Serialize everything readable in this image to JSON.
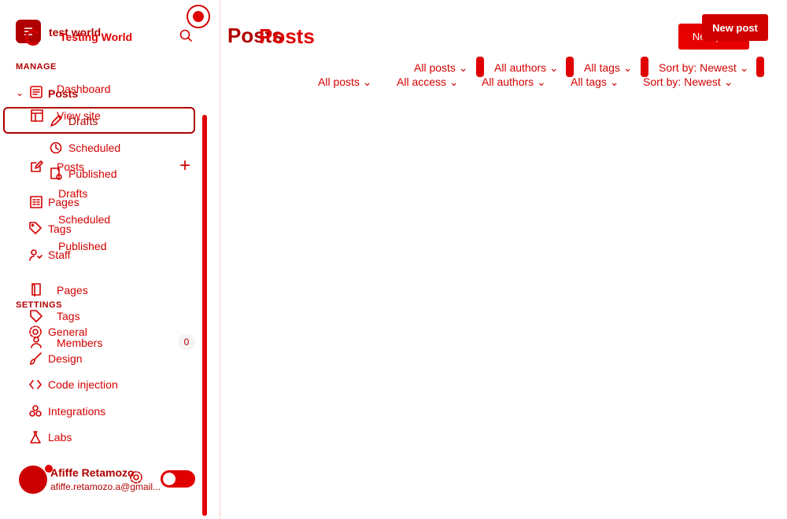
{
  "workspace": {
    "name_primary": "test world",
    "name_secondary": "Testing World"
  },
  "sidebar": {
    "manage_title": "MANAGE",
    "settings_title": "SETTINGS",
    "items_manage": [
      {
        "label": "Dashboard"
      },
      {
        "label": "View site"
      },
      {
        "label": "Posts"
      },
      {
        "label": "Drafts"
      },
      {
        "label": "Scheduled"
      },
      {
        "label": "Published"
      },
      {
        "label": "Pages"
      },
      {
        "label": "Tags"
      },
      {
        "label": "Members",
        "count": "0"
      }
    ],
    "posts_overlay": {
      "label": "Posts",
      "sub": [
        "Drafts",
        "Scheduled",
        "Published"
      ]
    },
    "ghost_labels": {
      "pages": "Pages",
      "tags": "Tags",
      "staff": "Staff"
    },
    "items_settings": [
      {
        "label": "General"
      },
      {
        "label": "Design"
      },
      {
        "label": "Code injection"
      },
      {
        "label": "Integrations"
      },
      {
        "label": "Labs"
      }
    ]
  },
  "user": {
    "name": "Afiffe Retamozo",
    "email": "afiffe.retamozo.a@gmail..."
  },
  "main": {
    "title_primary": "Posts",
    "title_secondary": "Posts",
    "new_post_primary": "New post",
    "new_post_secondary": "New post",
    "filters_row1": [
      "All posts",
      "All authors",
      "All tags",
      "Sort by: Newest"
    ],
    "filters_row2": [
      "All posts",
      "All access",
      "All authors",
      "All tags",
      "Sort by: Newest"
    ]
  }
}
